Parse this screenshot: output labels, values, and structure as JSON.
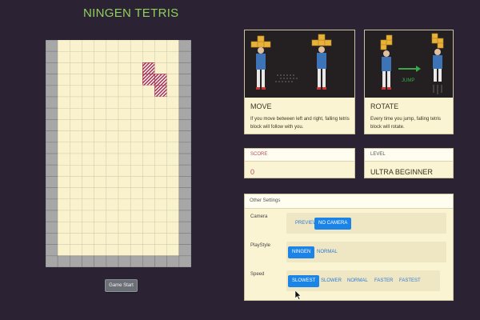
{
  "app": {
    "title": "NINGEN TETRIS"
  },
  "board": {
    "cols": 12,
    "rows": 20,
    "colors": {
      "empty": "#f9f2cd",
      "grid": "#cdc7ad",
      "wall": "#a7a7a7",
      "wall_line": "#7c7c7c",
      "piece": "#a8334e"
    },
    "active_piece": [
      [
        8,
        2
      ],
      [
        8,
        3
      ],
      [
        9,
        3
      ],
      [
        9,
        4
      ]
    ]
  },
  "controls": {
    "start_label": "Game Start"
  },
  "cards": {
    "move": {
      "title": "MOVE",
      "text": "If you move between left and right, falling tetris block will follow with you."
    },
    "rotate": {
      "title": "ROTATE",
      "text": "Every time you jump, falling tetris block will rotate.",
      "jump_label": "JUMP"
    }
  },
  "score": {
    "label": "SCORE",
    "value": "0"
  },
  "level": {
    "label": "LEVEL",
    "value": "ULTRA BEGINNER"
  },
  "settings": {
    "title": "Other Settings",
    "camera": {
      "label": "Camera",
      "options": [
        "PREVIEW",
        "NO CAMERA"
      ],
      "selected": "NO CAMERA"
    },
    "playstyle": {
      "label": "PlayStyle",
      "options": [
        "NINGEN",
        "NORMAL"
      ],
      "selected": "NINGEN"
    },
    "speed": {
      "label": "Speed",
      "options": [
        "SLOWEST",
        "SLOWER",
        "NORMAL",
        "FASTER",
        "FASTEST"
      ],
      "selected": "SLOWEST"
    }
  },
  "theme": {
    "accent": "#8fd15b",
    "primary": "#1c84e6",
    "score_color": "#b44d59",
    "background": "#2b2233"
  }
}
